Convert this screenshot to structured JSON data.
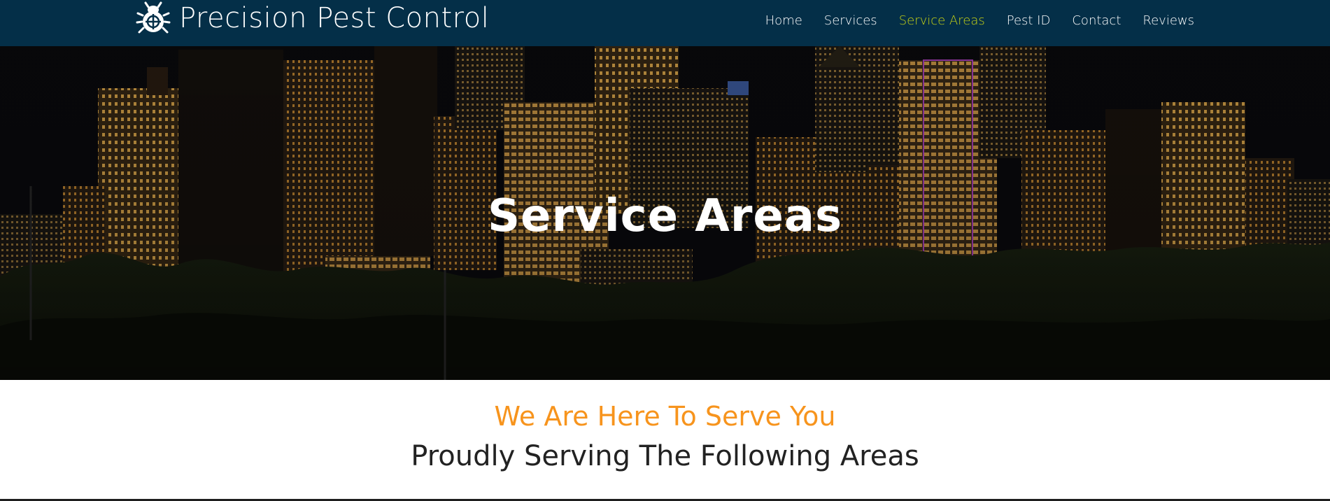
{
  "brand": {
    "name": "Precision Pest Control",
    "logo_icon": "bug-crosshair-icon"
  },
  "nav": {
    "items": [
      {
        "label": "Home",
        "active": false
      },
      {
        "label": "Services",
        "active": false
      },
      {
        "label": "Service Areas",
        "active": true
      },
      {
        "label": "Pest ID",
        "active": false
      },
      {
        "label": "Contact",
        "active": false
      },
      {
        "label": "Reviews",
        "active": false
      }
    ]
  },
  "hero": {
    "title": "Service Areas",
    "background": "night-city-skyline-image"
  },
  "section": {
    "subtitle": "We Are Here To Serve You",
    "title": "Proudly Serving The Following Areas"
  },
  "colors": {
    "navbar_bg": "#042f48",
    "nav_active": "#c7d314",
    "accent_orange": "#f7941d",
    "heading_dark": "#222222"
  }
}
